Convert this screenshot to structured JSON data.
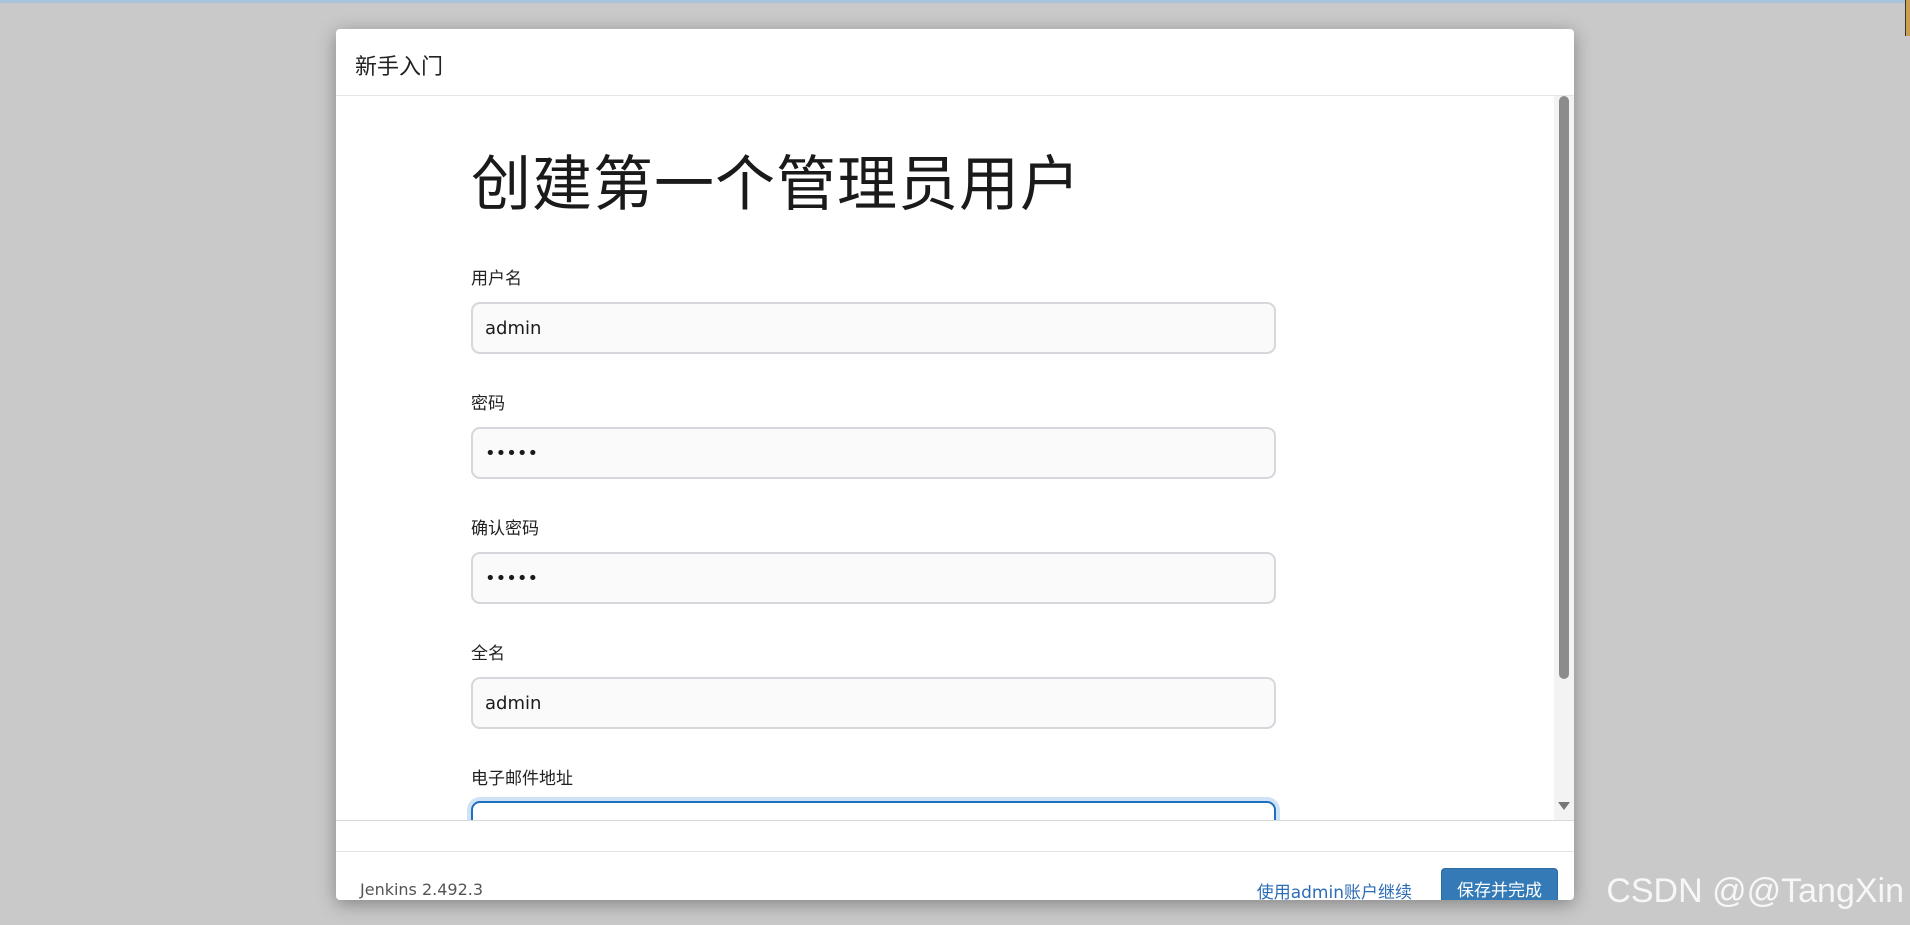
{
  "dialog": {
    "title": "新手入门"
  },
  "form": {
    "heading": "创建第一个管理员用户",
    "fields": [
      {
        "label": "用户名",
        "value": "admin",
        "type": "text"
      },
      {
        "label": "密码",
        "value": "•••••",
        "type": "password"
      },
      {
        "label": "确认密码",
        "value": "•••••",
        "type": "password"
      },
      {
        "label": "全名",
        "value": "admin",
        "type": "text"
      },
      {
        "label": "电子邮件地址",
        "value": "",
        "type": "email"
      }
    ]
  },
  "footer": {
    "version": "Jenkins 2.492.3",
    "continue_label": "使用admin账户继续",
    "save_label": "保存并完成"
  },
  "watermark": "CSDN @@TangXin",
  "colors": {
    "primary": "#337ab7",
    "link": "#2d6db5",
    "focus_border": "#1f6fc0"
  }
}
